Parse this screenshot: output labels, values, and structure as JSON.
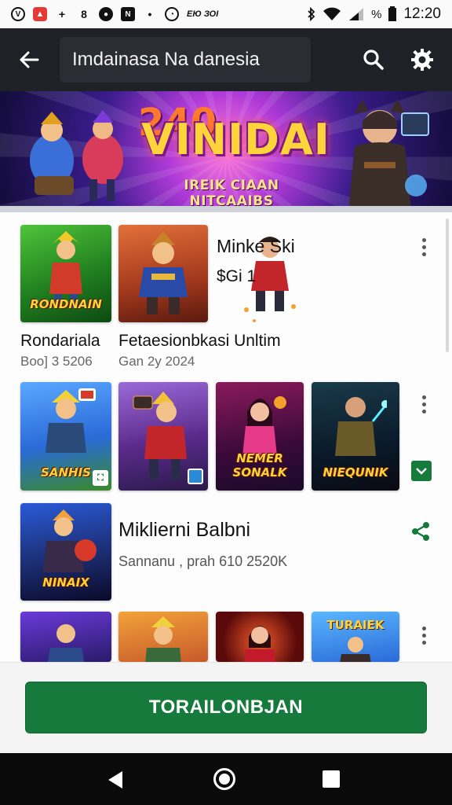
{
  "status_bar": {
    "icons": [
      "v-circle-icon",
      "red-app-icon",
      "plus-icon",
      "wave-icon",
      "record-icon",
      "n-app-icon",
      "dot-icon",
      "camera-icon"
    ],
    "small_text": "ЕЮ ЗОI",
    "time": "12:20"
  },
  "toolbar": {
    "title": "Imdainasa Na danesia"
  },
  "banner": {
    "number": "240",
    "title": "VINIDAI",
    "subtitle": "IREIK CIAAN NITCAAIBS"
  },
  "games": [
    {
      "title": "Rondariala",
      "meta": "Boo] 3 5206",
      "thumb_label": "RONDNAIN"
    },
    {
      "title": "Fetaesionbkasi Unltim",
      "meta": "Gan 2y 2024",
      "thumb_label": ""
    },
    {
      "title": "Minke Ski",
      "meta": "$Gi 1",
      "thumb_label": ""
    }
  ],
  "row2_labels": [
    "SANHIS",
    "",
    "NEMER SONALK",
    "NIEQUNIK"
  ],
  "featured": {
    "title": "Miklierni Balbni",
    "meta": "Sannanu , prah 610 2520K",
    "thumb_label": "NINAIX"
  },
  "row4_labels": [
    "",
    "",
    "",
    "TURAIEK"
  ],
  "bottom_button": "TORAILONBJAN",
  "colors": {
    "toolbar_bg": "#1e2126",
    "accent_green": "#157a3c",
    "nav_bg": "#0a0a0a"
  }
}
